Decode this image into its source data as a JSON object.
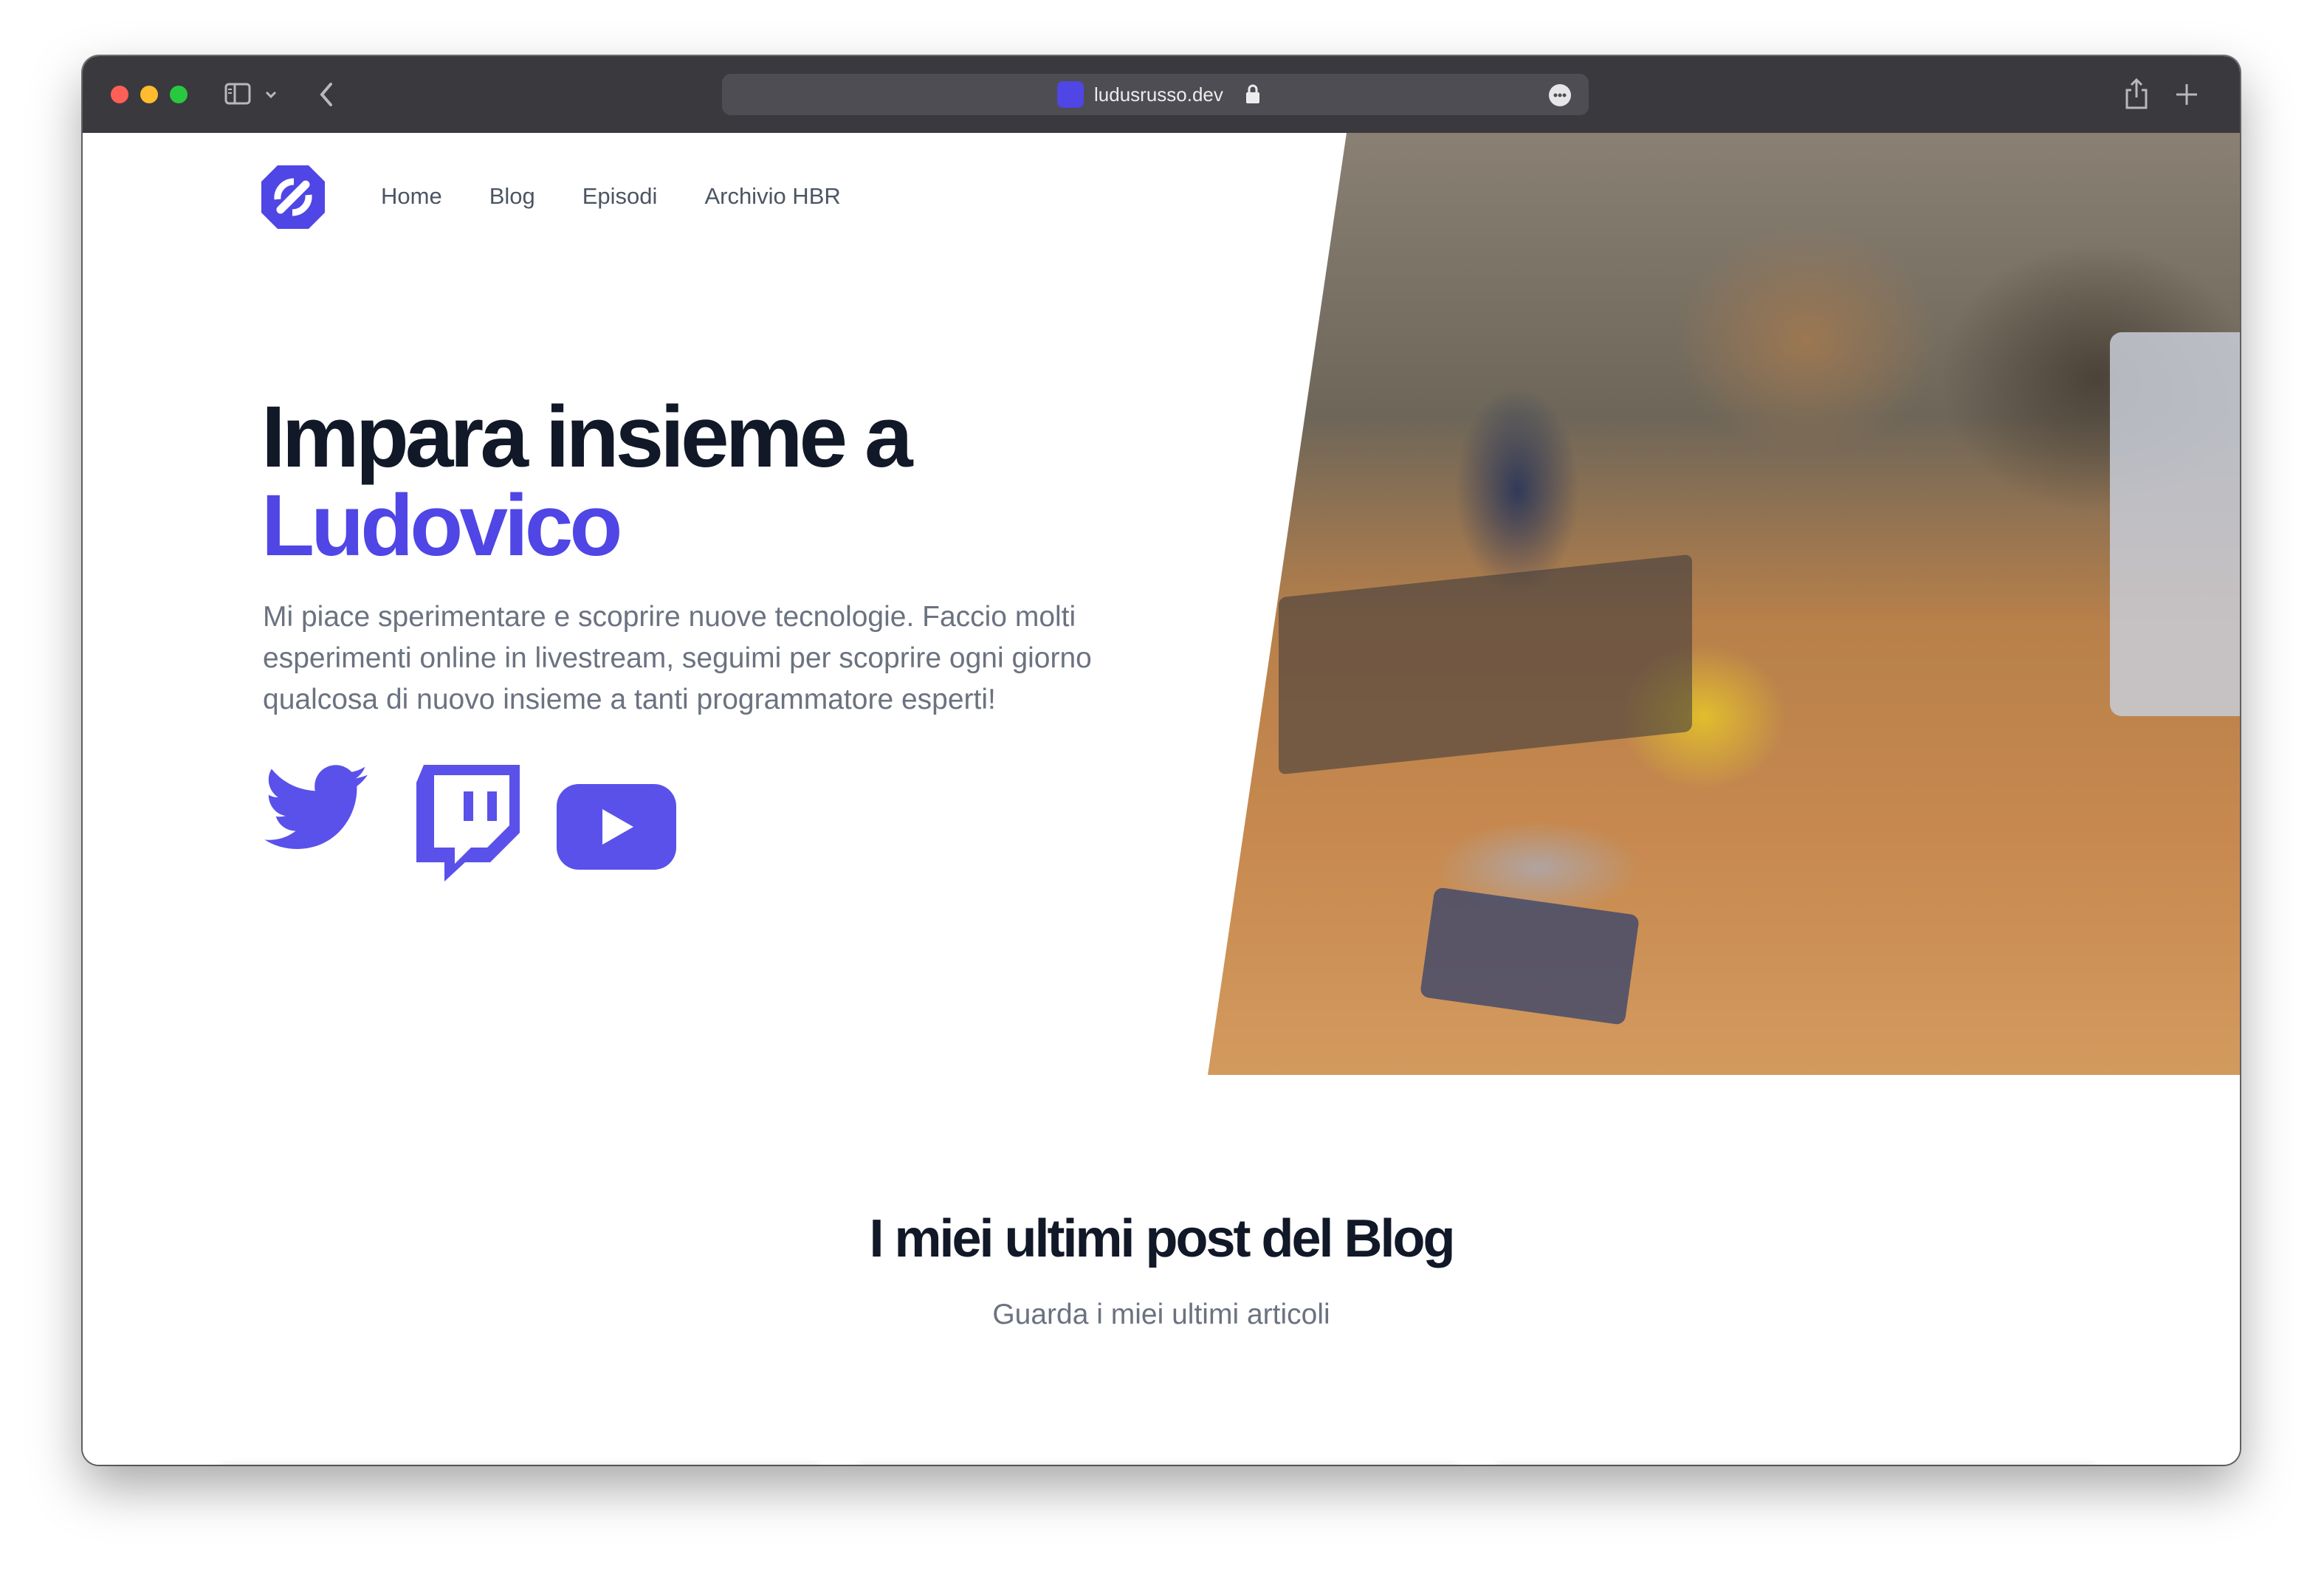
{
  "browser": {
    "url": "ludusrusso.dev",
    "icons": [
      "sidebar-icon",
      "chevron-down-icon",
      "back-icon",
      "lock-icon",
      "more-icon",
      "share-icon",
      "plus-icon"
    ]
  },
  "nav": {
    "items": [
      "Home",
      "Blog",
      "Episodi",
      "Archivio HBR"
    ]
  },
  "hero": {
    "title_line1": "Impara insieme a",
    "title_line2": "Ludovico",
    "description": "Mi piace sperimentare e scoprire nuove tecnologie. Faccio molti esperimenti online in livestream, seguimi per scoprire ogni giorno qualcosa di nuovo insieme a tanti programmatore esperti!",
    "social_icons": [
      "twitter-icon",
      "twitch-icon",
      "youtube-icon"
    ]
  },
  "blog": {
    "title": "I miei ultimi post del Blog",
    "subtitle": "Guarda i miei ultimi articoli",
    "cards": [
      {
        "emoji": "🔥"
      },
      {
        "emoji": "🤴"
      },
      {
        "emoji": "🔥"
      }
    ]
  },
  "colors": {
    "accent": "#4f46e5",
    "heading": "#111827",
    "body_text": "#6b7280",
    "toolbar": "#3a393e"
  }
}
